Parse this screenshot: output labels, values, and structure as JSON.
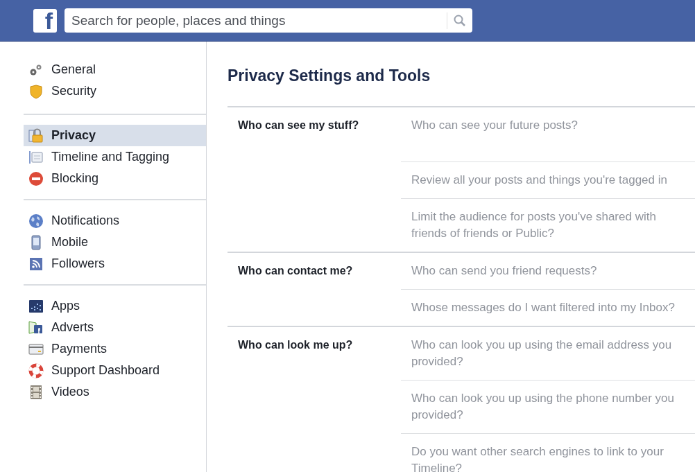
{
  "header": {
    "logo": "f",
    "search": {
      "placeholder": "Search for people, places and things"
    }
  },
  "sidebar": {
    "groups": [
      {
        "items": [
          {
            "label": "General",
            "kind": "gears",
            "selected": false
          },
          {
            "label": "Security",
            "kind": "badge",
            "selected": false
          }
        ]
      },
      {
        "items": [
          {
            "label": "Privacy",
            "kind": "lock",
            "selected": true
          },
          {
            "label": "Timeline and Tagging",
            "kind": "timeline",
            "selected": false
          },
          {
            "label": "Blocking",
            "kind": "block",
            "selected": false
          }
        ]
      },
      {
        "items": [
          {
            "label": "Notifications",
            "kind": "globe",
            "selected": false
          },
          {
            "label": "Mobile",
            "kind": "phone",
            "selected": false
          },
          {
            "label": "Followers",
            "kind": "rss",
            "selected": false
          }
        ]
      },
      {
        "items": [
          {
            "label": "Apps",
            "kind": "apps",
            "selected": false
          },
          {
            "label": "Adverts",
            "kind": "adverts",
            "selected": false
          },
          {
            "label": "Payments",
            "kind": "card",
            "selected": false
          },
          {
            "label": "Support Dashboard",
            "kind": "lifebuoy",
            "selected": false
          },
          {
            "label": "Videos",
            "kind": "film",
            "selected": false
          }
        ]
      }
    ]
  },
  "main": {
    "title": "Privacy Settings and Tools",
    "sections": [
      {
        "label": "Who can see my stuff?",
        "questions": [
          "Who can see your future posts?",
          "Review all your posts and things you're tagged in",
          "Limit the audience for posts you've shared with friends of friends or Public?"
        ]
      },
      {
        "label": "Who can contact me?",
        "questions": [
          "Who can send you friend requests?",
          "Whose messages do I want filtered into my Inbox?"
        ]
      },
      {
        "label": "Who can look me up?",
        "questions": [
          "Who can look you up using the email address you provided?",
          "Who can look you up using the phone number you provided?",
          "Do you want other search engines to link to your Timeline?"
        ]
      }
    ]
  }
}
